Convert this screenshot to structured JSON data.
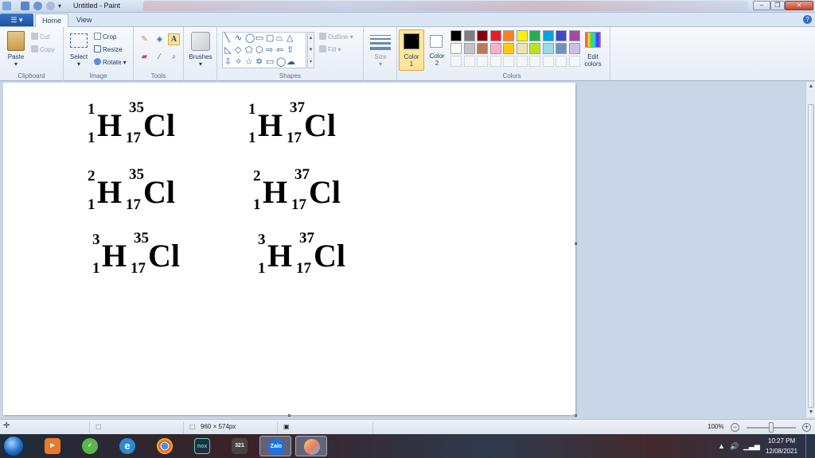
{
  "window": {
    "title": "Untitled - Paint"
  },
  "tabs": {
    "file_label": "▾",
    "home": "Home",
    "view": "View"
  },
  "ribbon": {
    "clipboard": {
      "paste": "Paste",
      "cut": "Cut",
      "copy": "Copy",
      "label": "Clipboard"
    },
    "image": {
      "select": "Select",
      "crop": "Crop",
      "resize": "Resize",
      "rotate": "Rotate",
      "label": "Image"
    },
    "tools": {
      "label": "Tools"
    },
    "brushes": {
      "label": "Brushes"
    },
    "shapes": {
      "outline": "Outline",
      "fill": "Fill",
      "label": "Shapes"
    },
    "size": {
      "label": "Size"
    },
    "color1": {
      "label": "Color",
      "num": "1",
      "value": "#000000"
    },
    "color2": {
      "label": "Color",
      "num": "2",
      "value": "#ffffff"
    },
    "colors": {
      "label": "Colors",
      "row1": [
        "#000000",
        "#7f7f7f",
        "#880015",
        "#ed1c24",
        "#ff7f27",
        "#fff200",
        "#22b14c",
        "#00a2e8",
        "#3f48cc",
        "#a349a4"
      ],
      "row2": [
        "#ffffff",
        "#c3c3c3",
        "#b97a57",
        "#ffaec9",
        "#ffc90e",
        "#efe4b0",
        "#b5e61d",
        "#99d9ea",
        "#7092be",
        "#c8bfe7"
      ]
    },
    "edit_colors": {
      "line1": "Edit",
      "line2": "colors"
    }
  },
  "canvas": {
    "isotopes": [
      {
        "h_mass": "1",
        "h_z": "1",
        "h": "H",
        "cl_mass": "35",
        "cl_z": "17",
        "cl": "Cl"
      },
      {
        "h_mass": "1",
        "h_z": "1",
        "h": "H",
        "cl_mass": "37",
        "cl_z": "17",
        "cl": "Cl"
      },
      {
        "h_mass": "2",
        "h_z": "1",
        "h": "H",
        "cl_mass": "35",
        "cl_z": "17",
        "cl": "Cl"
      },
      {
        "h_mass": "2",
        "h_z": "1",
        "h": "H",
        "cl_mass": "37",
        "cl_z": "17",
        "cl": "Cl"
      },
      {
        "h_mass": "3",
        "h_z": "1",
        "h": "H",
        "cl_mass": "35",
        "cl_z": "17",
        "cl": "Cl"
      },
      {
        "h_mass": "3",
        "h_z": "1",
        "h": "H",
        "cl_mass": "37",
        "cl_z": "17",
        "cl": "Cl"
      }
    ]
  },
  "status": {
    "dimensions": "960 × 574px",
    "zoom": "100%"
  },
  "taskbar": {
    "nox": "nox",
    "zalo": "Zalo",
    "num321": "321",
    "time": "10:27 PM",
    "date": "12/08/2021"
  }
}
